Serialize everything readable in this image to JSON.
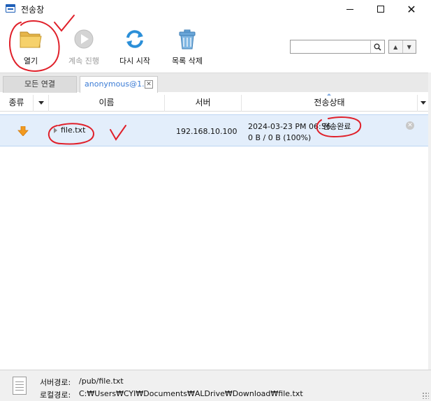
{
  "window": {
    "title": "전송창",
    "minimize": "–",
    "maximize": "□",
    "close": "✕"
  },
  "toolbar": {
    "open_label": "열기",
    "resume_label": "계속 진행",
    "restart_label": "다시 시작",
    "delete_label": "목록 삭제",
    "search_value": "",
    "nav_up": "▲",
    "nav_down": "▼"
  },
  "tabs": [
    {
      "label": "모든 연결",
      "active": false
    },
    {
      "label": "anonymous@1...",
      "active": true,
      "close": "✕"
    }
  ],
  "columns": {
    "type": "종류",
    "name": "이름",
    "server": "서버",
    "status": "전송상태"
  },
  "rows": [
    {
      "type": "download",
      "name": "file.txt",
      "server": "192.168.10.100",
      "time": "2024-03-23 PM 06:56",
      "status": "전송완료",
      "size": "0 B / 0 B (100%)",
      "close": "✕"
    }
  ],
  "footer": {
    "server_path_label": "서버경로:",
    "server_path": "/pub/file.txt",
    "local_path_label": "로컬경로:",
    "local_path": "C:₩Users₩CYI₩Documents₩ALDrive₩Download₩file.txt"
  },
  "colors": {
    "accent": "#3a7bd5",
    "selected_row": "#e3eefb",
    "annotation": "#e0202a",
    "download_arrow": "#f29a1f"
  }
}
